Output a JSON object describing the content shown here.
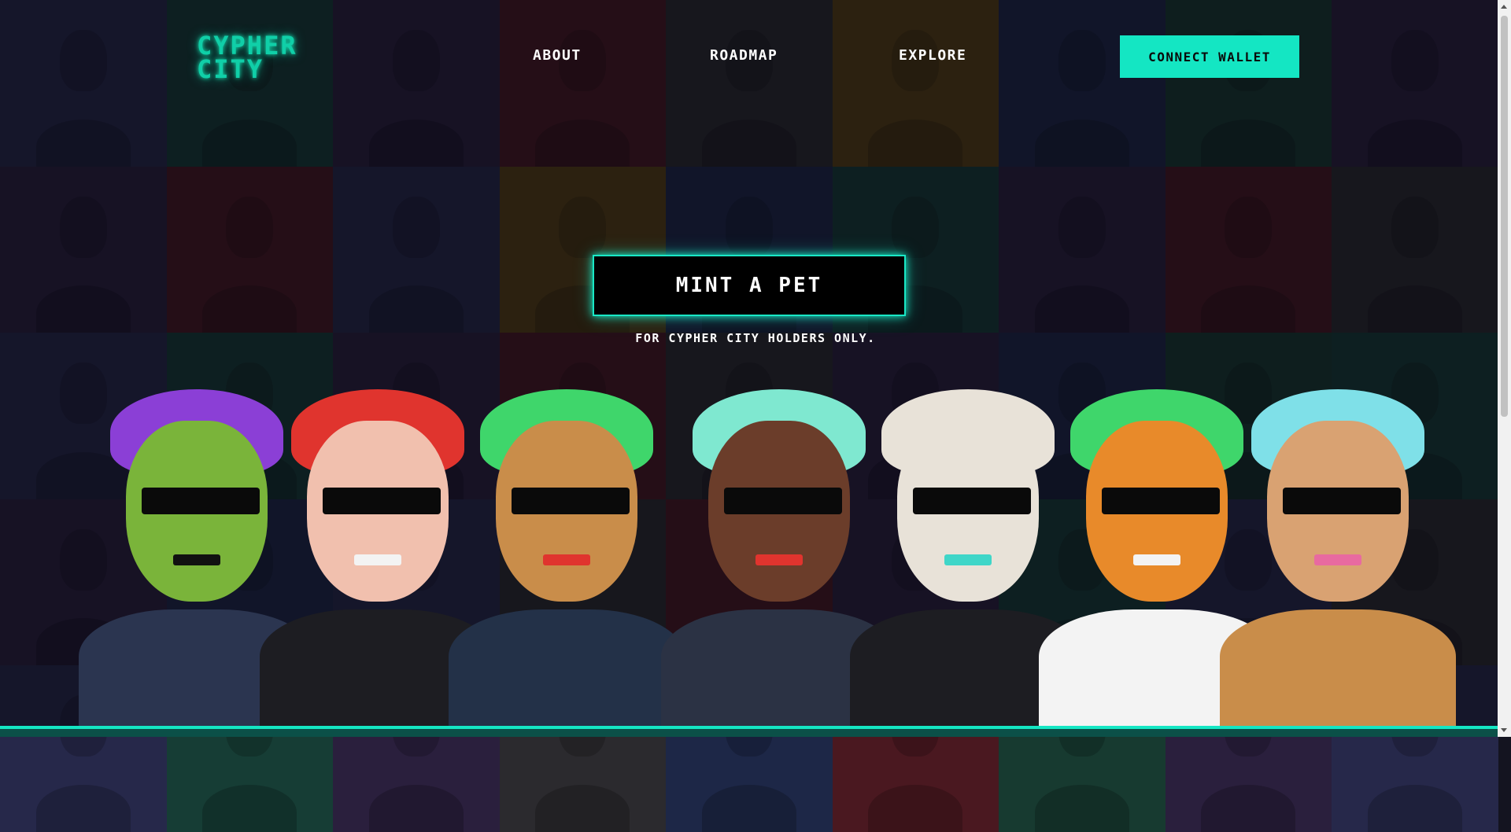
{
  "logo": {
    "text": "CYPHER CITY"
  },
  "nav": {
    "about": "ABOUT",
    "roadmap": "ROADMAP",
    "explore": "EXPLORE"
  },
  "header": {
    "connect_wallet": "CONNECT WALLET"
  },
  "hero": {
    "mint_label": "MINT A PET",
    "note": "FOR CYPHER CITY HOLDERS ONLY."
  },
  "colors": {
    "accent": "#14e6c3",
    "tiles": [
      "#26284a",
      "#163d35",
      "#2a1f3d",
      "#4a1820",
      "#2b2a2e",
      "#5a4210",
      "#1d2747",
      "#173a30",
      "#2a1f3d",
      "#2a1f3d",
      "#4a1820",
      "#26284a",
      "#5a4210",
      "#1d2747",
      "#163d35",
      "#2a1f3d",
      "#4a1820",
      "#2b2a2e",
      "#26284a",
      "#163d35",
      "#2a1f3d",
      "#4a1820",
      "#2b2a2e",
      "#2a1f3d",
      "#1d2747",
      "#173a30",
      "#163d35",
      "#2a1f3d",
      "#1d2747",
      "#26284a",
      "#2b2a2e",
      "#4a1820",
      "#2a1f3d",
      "#163d35",
      "#26284a",
      "#2b2a2e",
      "#26284a",
      "#163d35",
      "#2a1f3d",
      "#2b2a2e",
      "#1d2747",
      "#4a1820",
      "#173a30",
      "#2a1f3d",
      "#26284a"
    ]
  },
  "characters": [
    {
      "skin": "#7ab43a",
      "hair": "#8b3fd6",
      "shirt": "#2b3550",
      "mouth": "#111"
    },
    {
      "skin": "#f1c0ae",
      "hair": "#e0342e",
      "shirt": "#1d1d22",
      "mouth": "#f3f3f3"
    },
    {
      "skin": "#c98d4a",
      "hair": "#3fd66b",
      "shirt": "#233148",
      "mouth": "#e0342e"
    },
    {
      "skin": "#6b3d2a",
      "hair": "#7fe8d0",
      "shirt": "#2b3244",
      "mouth": "#e0342e"
    },
    {
      "skin": "#e8e2d8",
      "hair": "#e8e2d8",
      "shirt": "#1d1d22",
      "mouth": "#3fd6c8"
    },
    {
      "skin": "#e88a2a",
      "hair": "#3fd66b",
      "shirt": "#f3f3f3",
      "mouth": "#f3f3f3"
    },
    {
      "skin": "#d9a272",
      "hair": "#7fe0e8",
      "shirt": "#c98d4a",
      "mouth": "#e86aa0"
    }
  ]
}
